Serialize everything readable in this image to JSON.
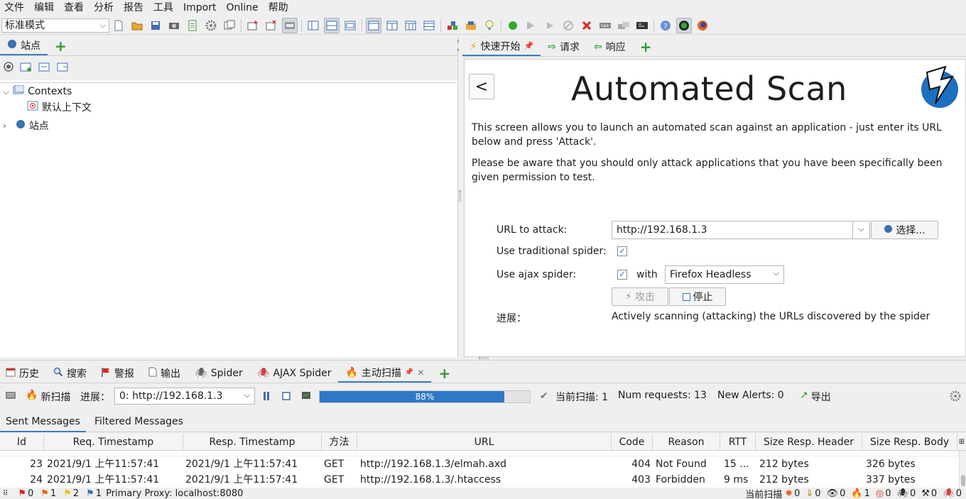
{
  "menu": [
    "文件",
    "编辑",
    "查看",
    "分析",
    "报告",
    "工具",
    "Import",
    "Online",
    "帮助"
  ],
  "toolbar": {
    "mode": "标准模式"
  },
  "left_panel": {
    "tab_label": "站点",
    "tree": {
      "contexts": "Contexts",
      "default_context": "默认上下文",
      "sites": "站点"
    }
  },
  "right_tabs": {
    "quick_start": "快速开始",
    "request": "请求",
    "response": "响应"
  },
  "quick_start": {
    "back": "<",
    "title": "Automated Scan",
    "para1": "This screen allows you to launch an automated scan against  an application - just enter its URL below and press 'Attack'.",
    "para2": "Please be aware that you should only attack applications that you have been specifically been given permission to test.",
    "url_label": "URL to attack:",
    "url_value": "http://192.168.1.3",
    "choose_button": "选择...",
    "traditional_spider_label": "Use traditional spider:",
    "ajax_spider_label": "Use ajax spider:",
    "with_label": "with",
    "browser": "Firefox Headless",
    "attack_button": "攻击",
    "stop_button": "停止",
    "progress_label": "进展：",
    "progress_text": "Actively scanning (attacking) the URLs discovered by the spider"
  },
  "bottom_tabs": [
    "历史",
    "搜索",
    "警报",
    "输出",
    "Spider",
    "AJAX Spider",
    "主动扫描"
  ],
  "scan_bar": {
    "new_scan": "新扫描",
    "progress_label": "进展：",
    "progress_select": "0: http://192.168.1.3",
    "progress_percent": 88,
    "progress_text": "88%",
    "current_scans": "当前扫描: 1",
    "num_requests": "Num requests: 13",
    "new_alerts": "New Alerts: 0",
    "export": "导出"
  },
  "sub_tabs": [
    "Sent Messages",
    "Filtered Messages"
  ],
  "table": {
    "headers": [
      "Id",
      "Req. Timestamp",
      "Resp. Timestamp",
      "方法",
      "URL",
      "Code",
      "Reason",
      "RTT",
      "Size Resp. Header",
      "Size Resp. Body"
    ],
    "rows": [
      [
        "23",
        "2021/9/1 上午11:57:41",
        "2021/9/1 上午11:57:41",
        "GET",
        "http://192.168.1.3/elmah.axd",
        "404",
        "Not Found",
        "15 ...",
        "212 bytes",
        "326 bytes"
      ],
      [
        "24",
        "2021/9/1 上午11:57:41",
        "2021/9/1 上午11:57:41",
        "GET",
        "http://192.168.1.3/.htaccess",
        "403",
        "Forbidden",
        "9 ms",
        "212 bytes",
        "337 bytes"
      ]
    ]
  },
  "status_bar": {
    "alert_high": "0",
    "alert_medium": "1",
    "alert_low": "2",
    "alert_info": "1",
    "proxy": "Primary Proxy: localhost:8080",
    "current_scans_label": "当前扫描",
    "counts": [
      "0",
      "0",
      "0",
      "1",
      "0",
      "0",
      "0",
      "0"
    ]
  },
  "colors": {
    "accent": "#3a7fc0",
    "progress": "#2f78c8",
    "green_plus": "#2f9b2f"
  }
}
